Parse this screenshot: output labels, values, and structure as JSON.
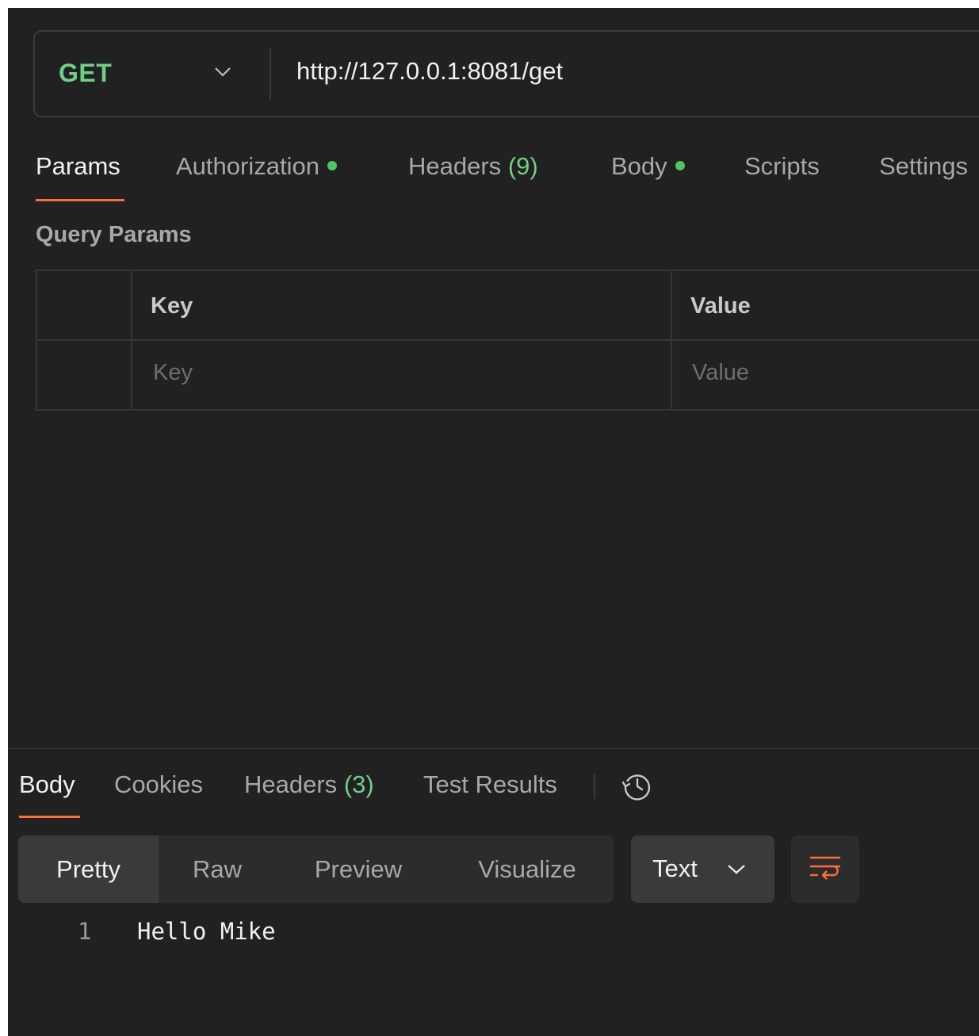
{
  "request": {
    "method": "GET",
    "url": "http://127.0.0.1:8081/get"
  },
  "request_tabs": [
    {
      "label": "Params",
      "active": true
    },
    {
      "label": "Authorization",
      "dot": true
    },
    {
      "label": "Headers",
      "count": "(9)"
    },
    {
      "label": "Body",
      "dot": true
    },
    {
      "label": "Scripts"
    },
    {
      "label": "Settings"
    }
  ],
  "query_params": {
    "title": "Query Params",
    "columns": [
      "Key",
      "Value"
    ],
    "placeholders": {
      "key": "Key",
      "value": "Value"
    }
  },
  "response_tabs": [
    {
      "label": "Body",
      "active": true
    },
    {
      "label": "Cookies"
    },
    {
      "label": "Headers",
      "count": "(3)"
    },
    {
      "label": "Test Results"
    }
  ],
  "view_modes": [
    "Pretty",
    "Raw",
    "Preview",
    "Visualize"
  ],
  "active_view_mode": "Pretty",
  "format": "Text",
  "response_body": {
    "lines": [
      {
        "number": "1",
        "text": "Hello Mike"
      }
    ]
  },
  "colors": {
    "background": "#212121",
    "accent": "#ff6c37",
    "method": "#6fcf86",
    "status_dot": "#4fc460"
  },
  "icons": {
    "method_dropdown": "chevron-down-icon",
    "history": "history-icon",
    "format_dropdown": "chevron-down-icon",
    "wrap": "wrap-lines-icon"
  }
}
